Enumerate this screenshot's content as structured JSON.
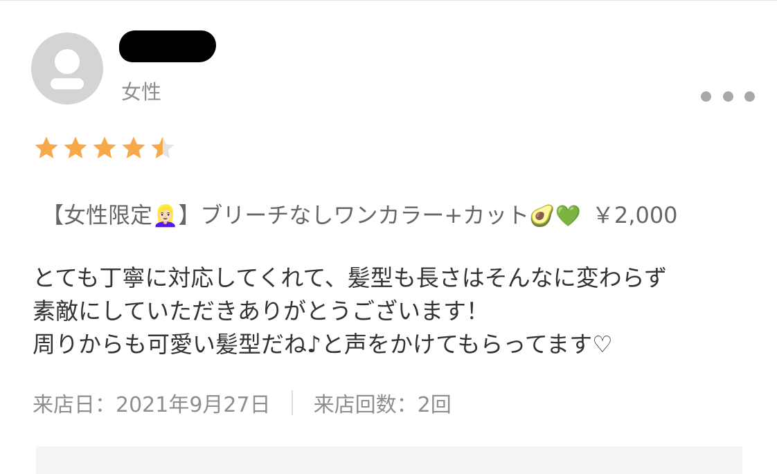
{
  "reviewer": {
    "avatar_icon": "person-icon",
    "gender": "女性"
  },
  "rating": {
    "value": 4.5,
    "max": 5,
    "star_color": "#f7a94a"
  },
  "menu": {
    "prefix": "【女性限定",
    "emoji_1": "👱🏻‍♀️",
    "suffix": "】ブリーチなしワンカラー+カット",
    "emoji_2": "🥑💚",
    "price": "￥2,000"
  },
  "review": {
    "text": "とても丁寧に対応してくれて、髪型も長さはそんなに変わらず\n素敵にしていただきありがとうございます！\n周りからも可愛い髪型だね♪と声をかけてもらってます♡"
  },
  "visit": {
    "date": "来店日：2021年9月27日",
    "count": "来店回数：2回"
  },
  "menu_icon": "more-horizontal-icon"
}
